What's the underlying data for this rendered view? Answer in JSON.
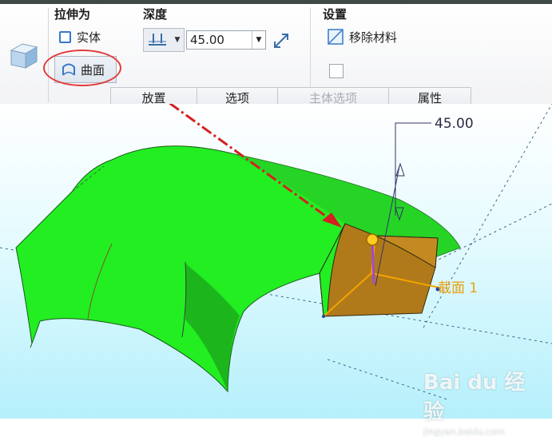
{
  "ribbon": {
    "extrude_as": {
      "title": "拉伸为",
      "solid": "实体",
      "surface": "曲面"
    },
    "depth": {
      "title": "深度",
      "value": "45.00"
    },
    "settings": {
      "title": "设置",
      "remove_material": "移除材料"
    },
    "tabs": [
      {
        "label": "放置",
        "enabled": true
      },
      {
        "label": "选项",
        "enabled": true
      },
      {
        "label": "主体选项",
        "enabled": false
      },
      {
        "label": "属性",
        "enabled": true
      }
    ]
  },
  "viewport": {
    "dimension_label": "45.00",
    "section_label": "截面 1"
  },
  "watermark": {
    "logo": "Bai du 经验",
    "url": "jingyan.baidu.com"
  },
  "colors": {
    "surface": "#22ee22",
    "section": "#b07a1a",
    "annotation_red": "#d42020",
    "dimension": "#333366"
  }
}
